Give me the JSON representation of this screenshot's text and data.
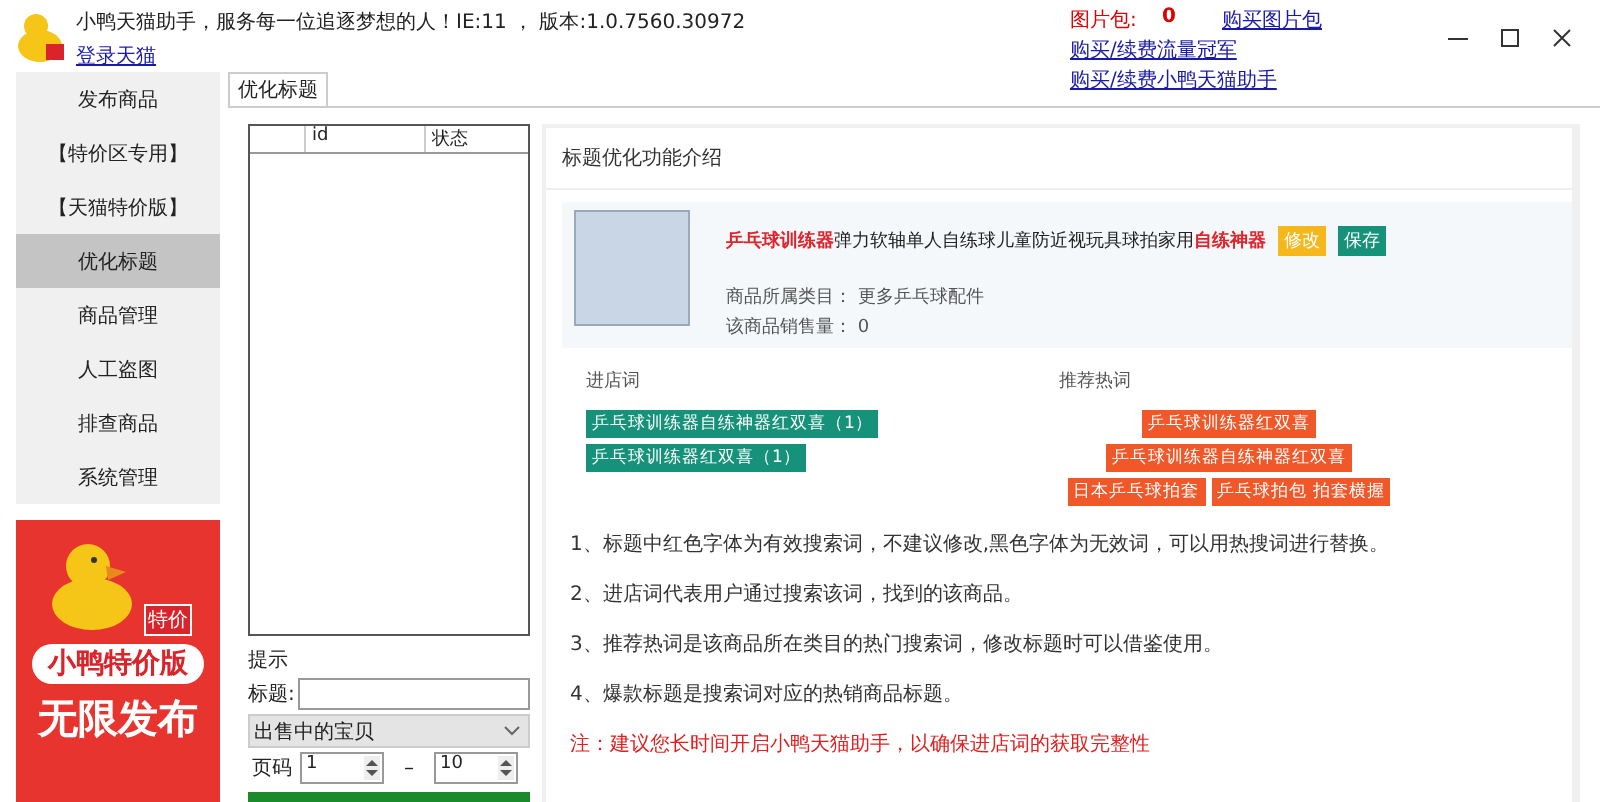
{
  "header": {
    "title": "小鸭天猫助手，服务每一位追逐梦想的人！IE:11 ， 版本:1.0.7560.30972",
    "login_link": "登录天猫",
    "picture_pack_label": "图片包:",
    "picture_pack_count": "0",
    "links": [
      "购买图片包",
      "购买/续费流量冠军",
      "购买/续费小鸭天猫助手"
    ]
  },
  "sidebar": {
    "items": [
      {
        "label": "发布商品",
        "selected": false
      },
      {
        "label": "【特价区专用】",
        "selected": false
      },
      {
        "label": "【天猫特价版】",
        "selected": false
      },
      {
        "label": "优化标题",
        "selected": true
      },
      {
        "label": "商品管理",
        "selected": false
      },
      {
        "label": "人工盗图",
        "selected": false
      },
      {
        "label": "排查商品",
        "selected": false
      },
      {
        "label": "系统管理",
        "selected": false
      }
    ],
    "banner": {
      "badge": "特价",
      "brand": "小鸭特价版",
      "slogan": "无限发布"
    }
  },
  "tabs": [
    {
      "label": "优化标题",
      "selected": true
    }
  ],
  "list": {
    "columns": [
      "",
      "id",
      "状态"
    ]
  },
  "form": {
    "hint": "提示",
    "title_label": "标题:",
    "filter": "出售中的宝贝",
    "page_label": "页码",
    "page_from": "1",
    "dash": "–",
    "page_to": "10"
  },
  "intro": {
    "heading": "标题优化功能介绍",
    "product": {
      "title": "**乒乓球训练器**弹力软轴单人自练球儿童防近视玩具球拍家用**自练神器**",
      "edit_button": "修改",
      "save_button": "保存",
      "category": "商品所属类目：  更多乒乓球配件",
      "sales": "该商品销售量：  0"
    },
    "store_words": {
      "heading": "进店词",
      "tags": [
        "乒乓球训练器自练神器红双喜（1）",
        "乒乓球训练器红双喜（1）"
      ]
    },
    "hot_words": {
      "heading": "推荐热词",
      "tags": [
        "乒乓球训练器红双喜",
        "乒乓球训练器自练神器红双喜",
        "日本乒乓球拍套",
        "乒乓球拍包 拍套横握"
      ]
    },
    "notes": [
      {
        "text": "1、标题中红色字体为有效搜索词，不建议修改,黑色字体为无效词，可以用热搜词进行替换。",
        "kind": "normal"
      },
      {
        "text": "2、进店词代表用户通过搜索该词，找到的该商品。",
        "kind": "normal"
      },
      {
        "text": "3、推荐热词是该商品所在类目的热门搜索词，修改标题时可以借鉴使用。",
        "kind": "normal"
      },
      {
        "text": "4、爆款标题是搜索词对应的热销商品标题。",
        "kind": "normal"
      },
      {
        "text": "注：建议您长时间开启小鸭天猫助手，以确保进店词的获取完整性",
        "kind": "warning"
      }
    ]
  }
}
